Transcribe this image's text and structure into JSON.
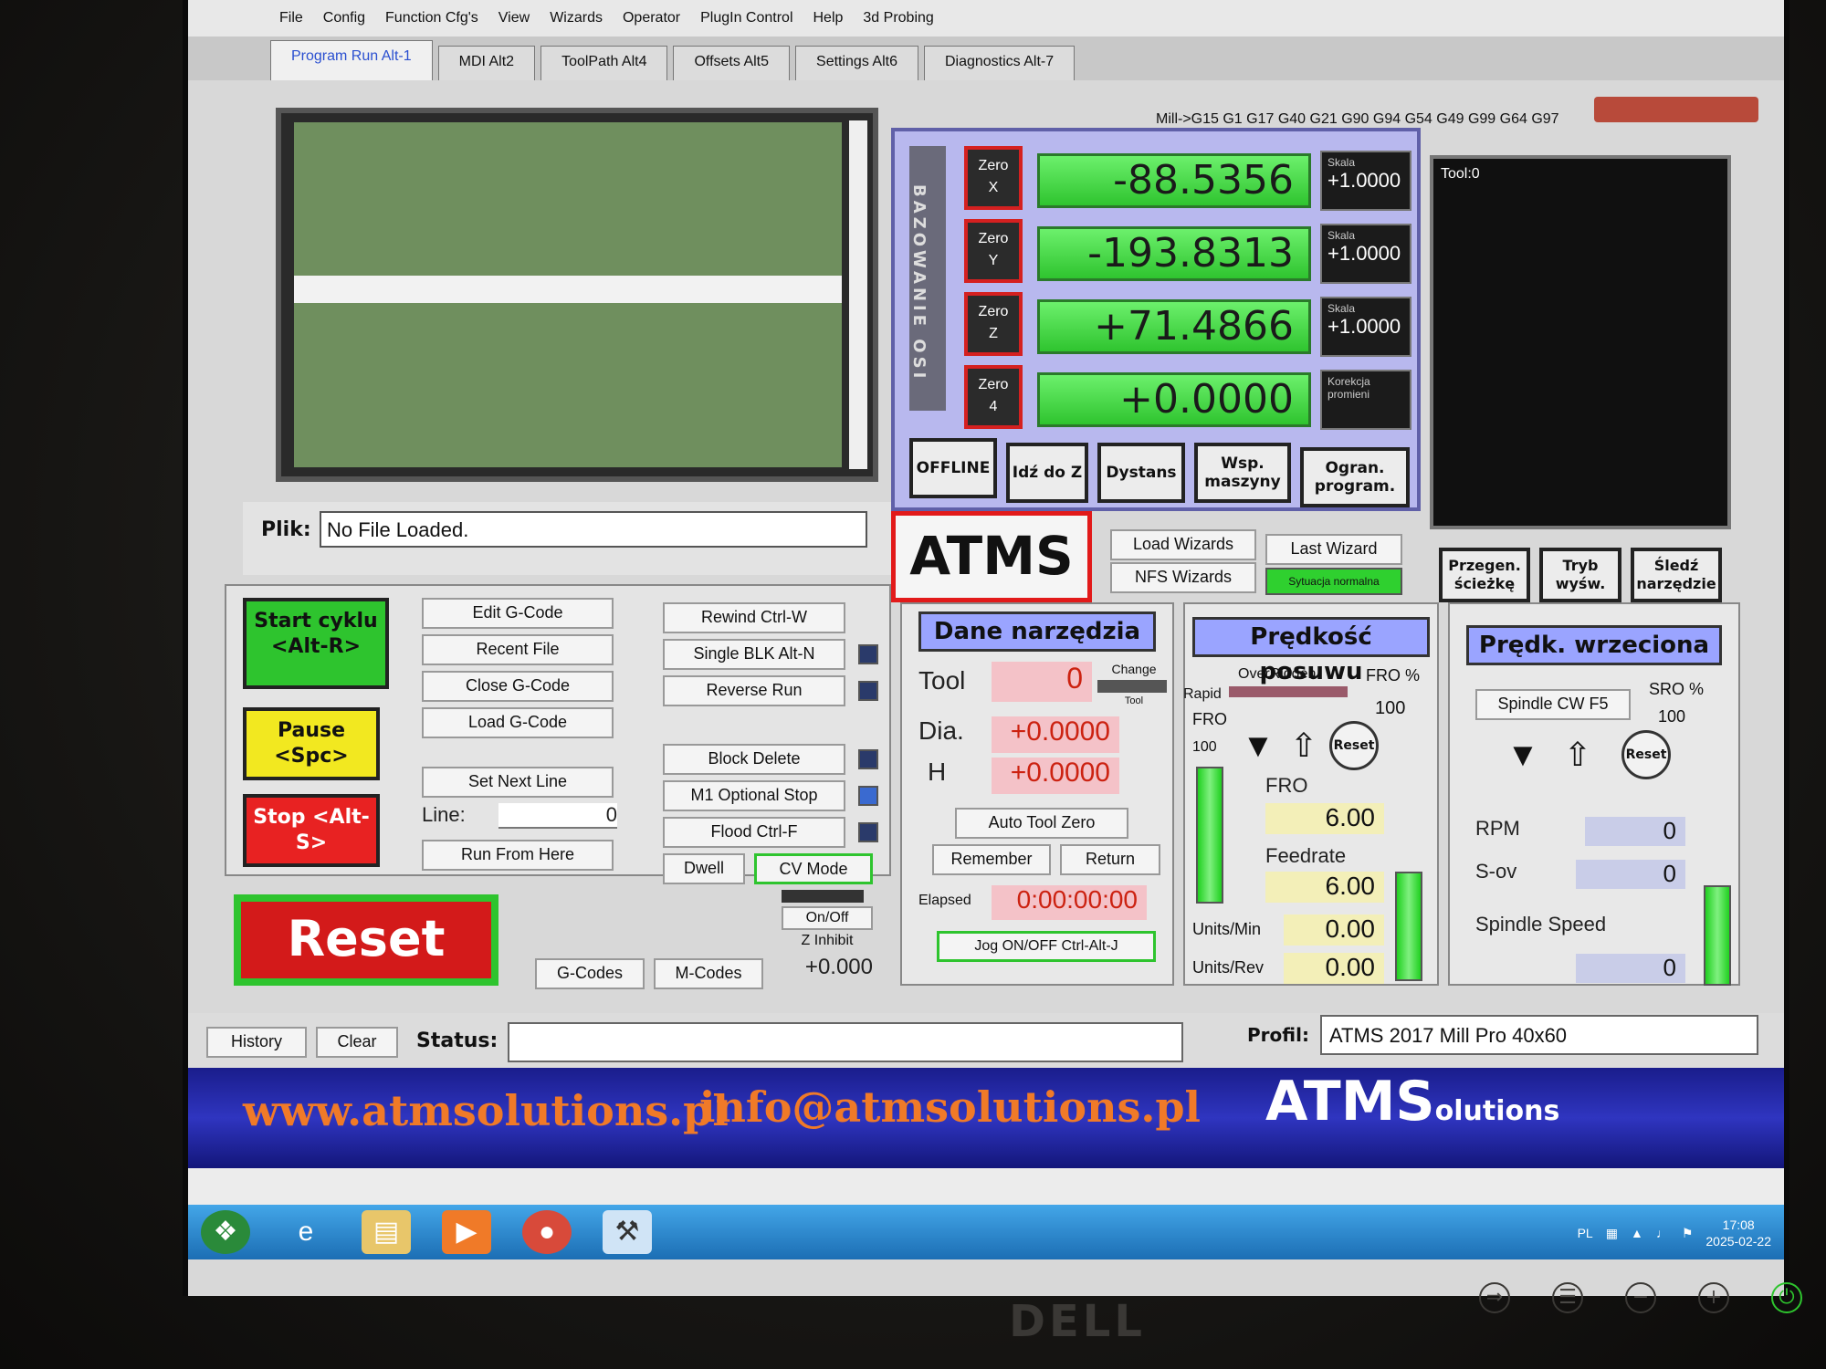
{
  "menu": [
    "File",
    "Config",
    "Function Cfg's",
    "View",
    "Wizards",
    "Operator",
    "PlugIn Control",
    "Help",
    "3d Probing"
  ],
  "tabs": [
    "Program Run Alt-1",
    "MDI Alt2",
    "ToolPath Alt4",
    "Offsets Alt5",
    "Settings Alt6",
    "Diagnostics Alt-7"
  ],
  "modal_line": "Mill->G15  G1 G17 G40 G21 G90 G94 G54 G49 G99 G64 G97",
  "axis_label": "BAZOWANIE OSI",
  "dro": {
    "axes": [
      {
        "zero": "Zero",
        "axis": "X",
        "value": "-88.5356",
        "scale_label": "Skala",
        "scale": "+1.0000"
      },
      {
        "zero": "Zero",
        "axis": "Y",
        "value": "-193.8313",
        "scale_label": "Skala",
        "scale": "+1.0000"
      },
      {
        "zero": "Zero",
        "axis": "Z",
        "value": "+71.4866",
        "scale_label": "Skala",
        "scale": "+1.0000"
      },
      {
        "zero": "Zero",
        "axis": "4",
        "value": "+0.0000",
        "scale_label": "Korekcja promieni",
        "scale": ""
      }
    ],
    "buttons": [
      "OFFLINE",
      "Idź do Z",
      "Dystans",
      "Wsp. maszyny",
      "Ogran. program."
    ]
  },
  "tool_display": "Tool:0",
  "file": {
    "label": "Plik:",
    "value": "No File Loaded."
  },
  "logo": "ATMS",
  "wizards": {
    "load": "Load Wizards",
    "last": "Last Wizard",
    "nfs": "NFS Wizards",
    "sytuacja": "Sytuacja normalna"
  },
  "view_buttons": [
    "Przegen. ścieżkę",
    "Tryb wyśw.",
    "Śledź narzędzie"
  ],
  "controls": {
    "start": "Start cyklu <Alt-R>",
    "pause": "Pause <Spc>",
    "stop": "Stop <Alt-S>",
    "edit": "Edit G-Code",
    "recent": "Recent File",
    "close": "Close G-Code",
    "load": "Load G-Code",
    "set_next": "Set Next Line",
    "line_label": "Line:",
    "line_value": "0",
    "run_from": "Run From Here",
    "rewind": "Rewind Ctrl-W",
    "single": "Single BLK Alt-N",
    "reverse": "Reverse Run",
    "block_delete": "Block Delete",
    "m1": "M1 Optional Stop",
    "flood": "Flood Ctrl-F",
    "dwell": "Dwell",
    "cv": "CV Mode",
    "reset": "Reset",
    "gcodes": "G-Codes",
    "mcodes": "M-Codes",
    "onoff": "On/Off",
    "zinhibit": "Z Inhibit",
    "zinhibit_val": "+0.000"
  },
  "tooldata": {
    "title": "Dane narzędzia",
    "tool_label": "Tool",
    "tool_value": "0",
    "change": "Change",
    "tool_small": "Tool",
    "dia_label": "Dia.",
    "dia_value": "+0.0000",
    "h_label": "H",
    "h_value": "+0.0000",
    "auto_zero": "Auto Tool Zero",
    "remember": "Remember",
    "return": "Return",
    "elapsed_label": "Elapsed",
    "elapsed_value": "0:00:00:00",
    "jog": "Jog ON/OFF Ctrl-Alt-J"
  },
  "feed": {
    "title": "Prędkość posuwu",
    "overridden": "OverRidden",
    "fro_pct_label": "FRO %",
    "fro_pct": "100",
    "rapid": "Rapid",
    "fro": "FRO",
    "rapid_val": "100",
    "reset": "Reset",
    "fro_label": "FRO",
    "fro_value": "6.00",
    "feedrate_label": "Feedrate",
    "feedrate_value": "6.00",
    "units_min_label": "Units/Min",
    "units_min": "0.00",
    "units_rev_label": "Units/Rev",
    "units_rev": "0.00"
  },
  "spindle": {
    "title": "Prędk. wrzeciona",
    "sro_label": "SRO %",
    "sro": "100",
    "cw": "Spindle CW F5",
    "reset": "Reset",
    "rpm_label": "RPM",
    "rpm": "0",
    "sov_label": "S-ov",
    "sov": "0",
    "speed_label": "Spindle Speed",
    "speed": "0"
  },
  "status": {
    "history": "History",
    "clear": "Clear",
    "label": "Status:",
    "value": "",
    "profile_label": "Profil:",
    "profile": "ATMS 2017 Mill Pro 40x60"
  },
  "banner": {
    "web": "www.atmsolutions.pl",
    "mail": "info@atmsolutions.pl",
    "logo_big": "ATMS",
    "logo_small": "olutions"
  },
  "tray": {
    "lang": "PL",
    "time": "17:08",
    "date": "2025-02-22"
  },
  "brand": "DELL"
}
